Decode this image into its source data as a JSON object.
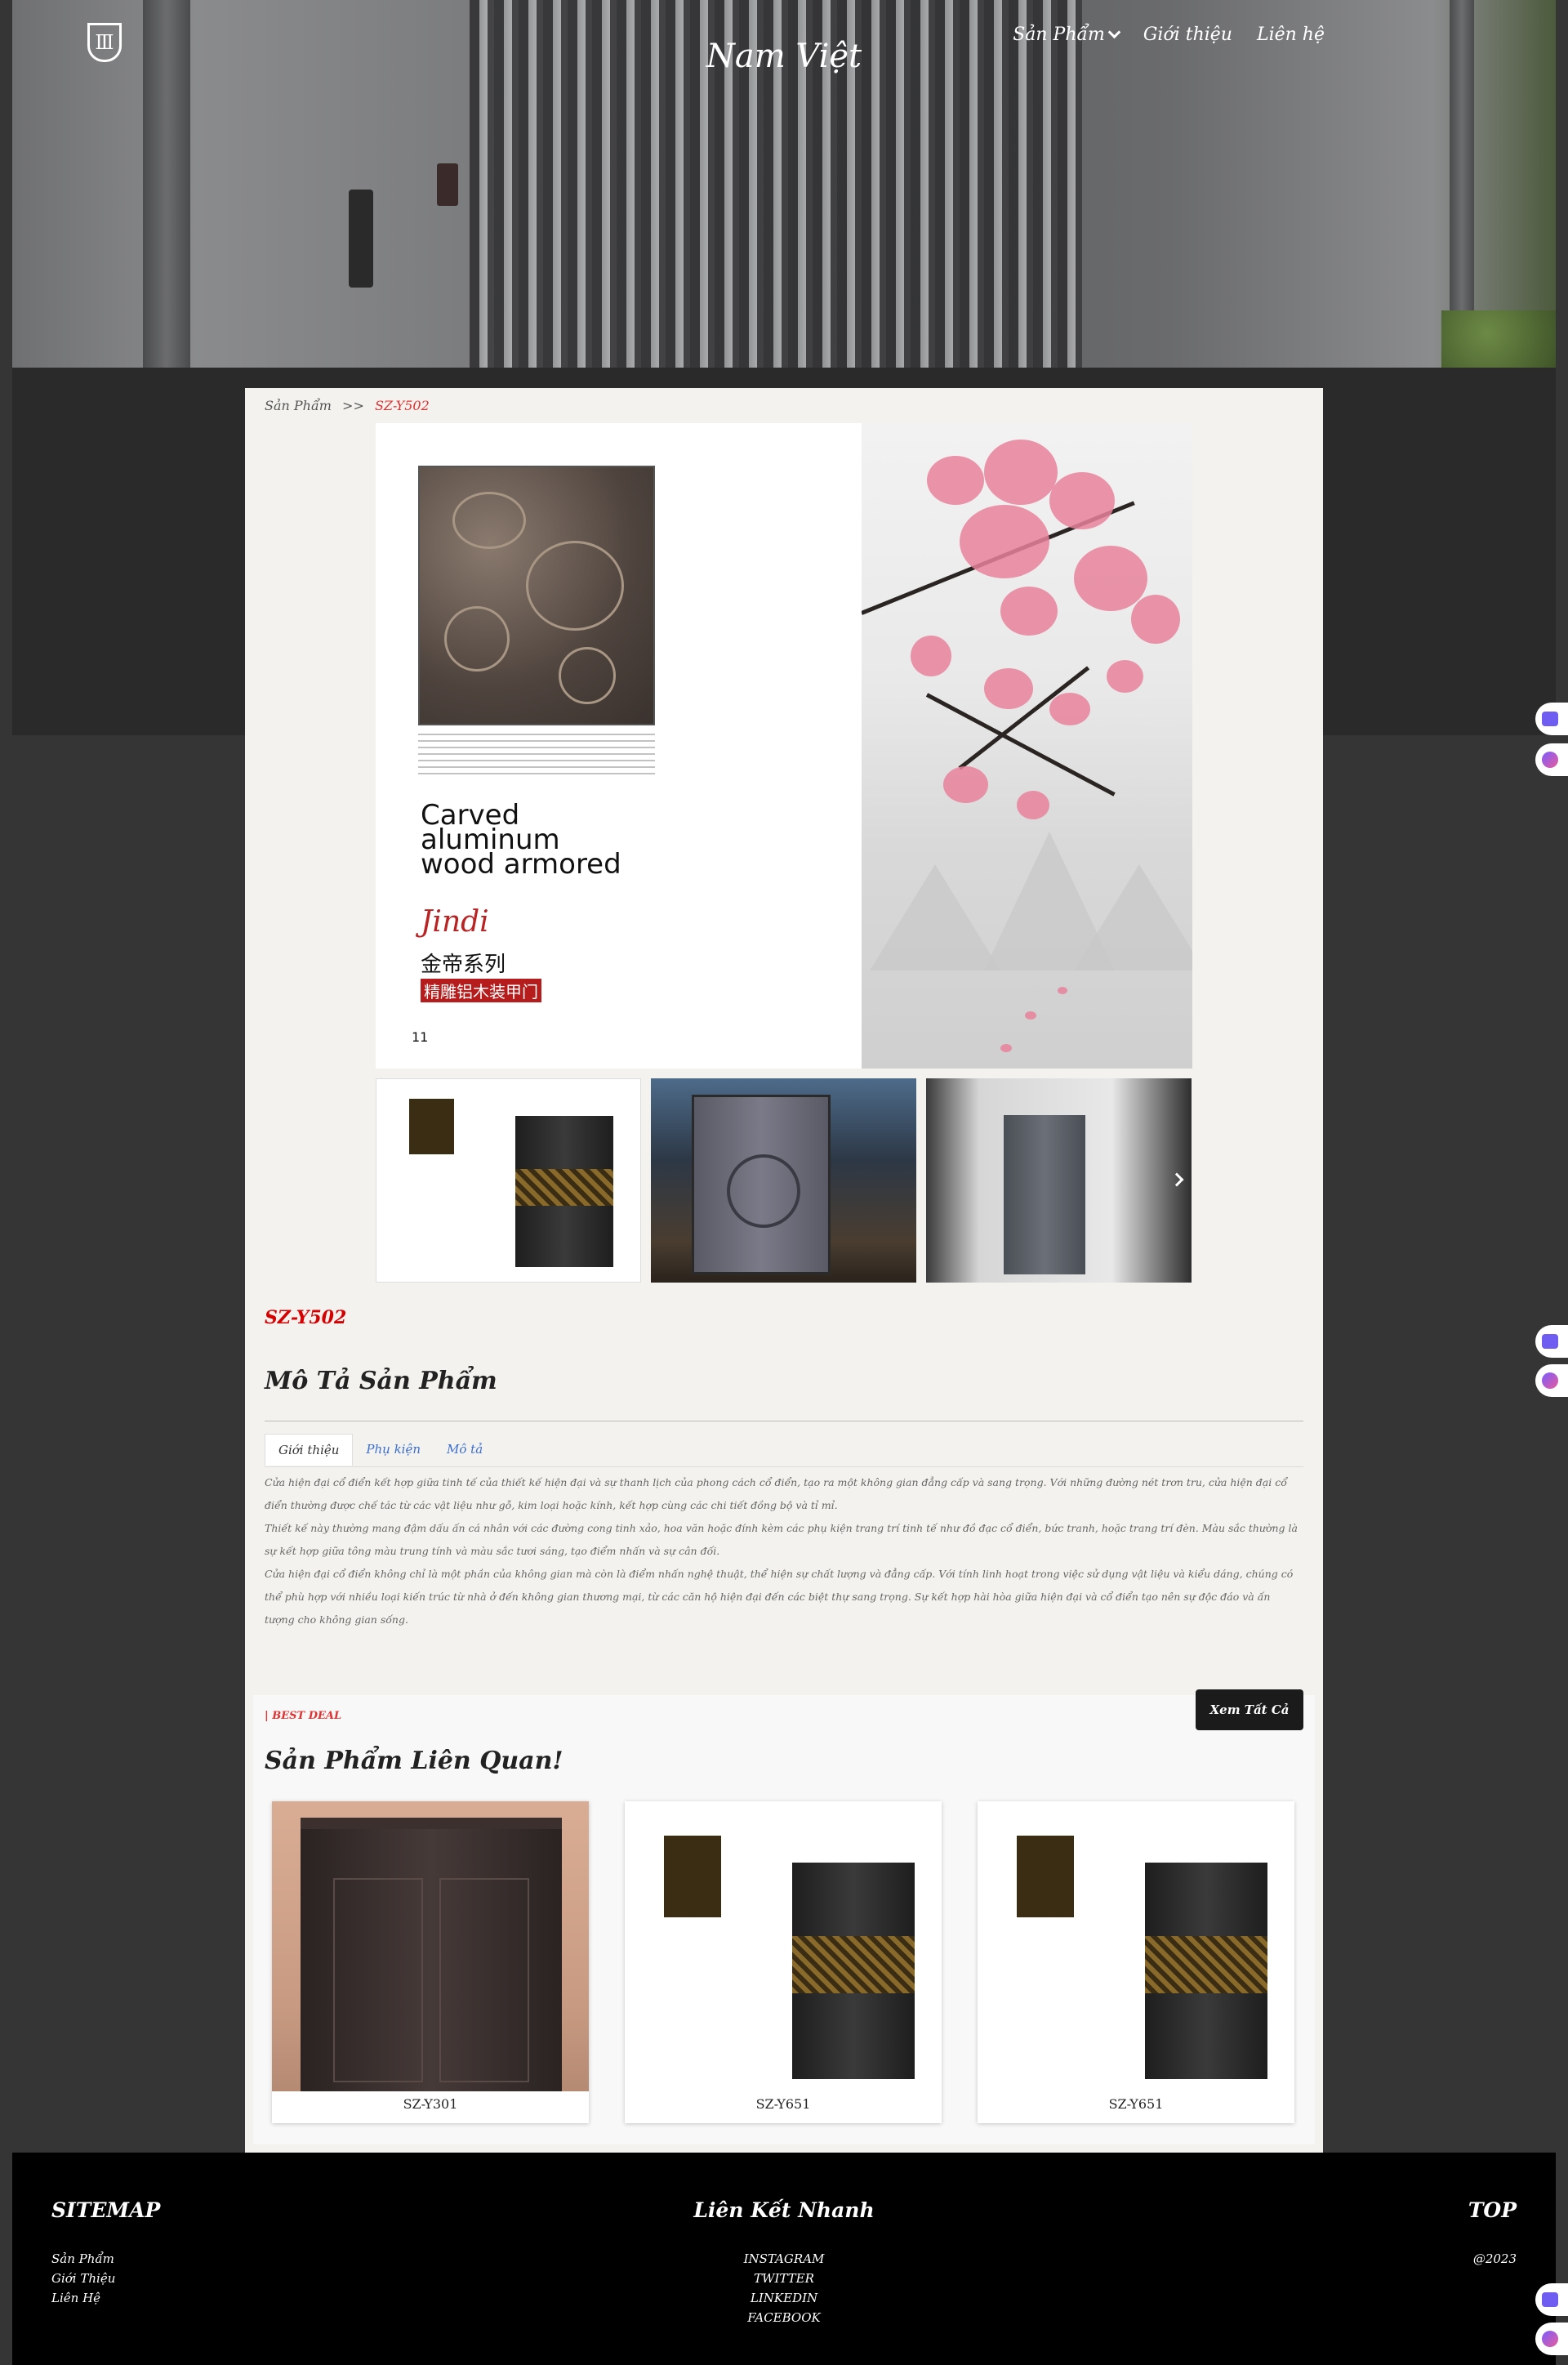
{
  "header": {
    "brand": "Nam Việt",
    "nav": [
      {
        "label": "Sản Phẩm"
      },
      {
        "label": "Giới thiệu"
      },
      {
        "label": "Liên hệ"
      }
    ]
  },
  "breadcrumb": {
    "parent": "Sản Phẩm",
    "separator": ">>",
    "current": "SZ-Y502"
  },
  "main_image": {
    "carved_title": "Carved aluminum wood armored",
    "script_name": "Jindi",
    "cn_series": "金帝系列",
    "cn_subtitle": "精雕铝木装甲门",
    "page_number": "11"
  },
  "product": {
    "code": "SZ-Y502",
    "description_title": "Mô Tả Sản Phẩm",
    "tabs": [
      "Giới thiệu",
      "Phụ kiện",
      "Mô tả"
    ],
    "description": [
      "Cửa hiện đại cổ điển kết hợp giữa tinh tế của thiết kế hiện đại và sự thanh lịch của phong cách cổ điển, tạo ra một không gian đẳng cấp và sang trọng. Với những đường nét trơn tru, cửa hiện đại cổ điển thường được chế tác từ các vật liệu như gỗ, kim loại hoặc kính, kết hợp cùng các chi tiết đồng bộ và tỉ mỉ.",
      "Thiết kế này thường mang đậm dấu ấn cá nhân với các đường cong tinh xảo, hoa văn hoặc đính kèm các phụ kiện trang trí tinh tế như đồ đạc cổ điển, bức tranh, hoặc trang trí đèn. Màu sắc thường là sự kết hợp giữa tông màu trung tính và màu sắc tươi sáng, tạo điểm nhấn và sự cân đối.",
      "Cửa hiện đại cổ điển không chỉ là một phần của không gian mà còn là điểm nhấn nghệ thuật, thể hiện sự chất lượng và đẳng cấp. Với tính linh hoạt trong việc sử dụng vật liệu và kiểu dáng, chúng có thể phù hợp với nhiều loại kiến trúc từ nhà ở đến không gian thương mại, từ các căn hộ hiện đại đến các biệt thự sang trọng. Sự kết hợp hài hòa giữa hiện đại và cổ điển tạo nên sự độc đáo và ấn tượng cho không gian sống."
    ]
  },
  "related": {
    "tag": "| BEST DEAL",
    "view_all": "Xem Tất Cả",
    "title": "Sản Phẩm Liên Quan!",
    "items": [
      {
        "name": "SZ-Y301"
      },
      {
        "name": "SZ-Y651"
      },
      {
        "name": "SZ-Y651"
      }
    ]
  },
  "footer": {
    "sitemap_title": "SITEMAP",
    "sitemap_links": [
      "Sản Phẩm",
      "Giới Thiệu",
      "Liên Hệ"
    ],
    "quick_title": "Liên Kết Nhanh",
    "quick_links": [
      "INSTAGRAM",
      "TWITTER",
      "LINKEDIN",
      "FACEBOOK"
    ],
    "top_label": "TOP",
    "copyright": "@2023"
  },
  "icons": {
    "logo": "logo-icon",
    "nav_dropdown": "chevron-down-icon",
    "carousel_next": "chevron-right-icon"
  }
}
